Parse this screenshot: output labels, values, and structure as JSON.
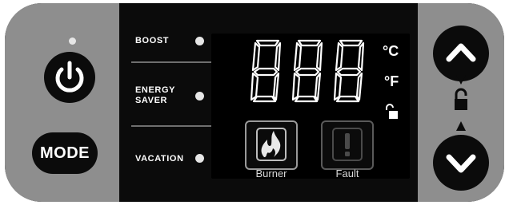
{
  "controls": {
    "mode_label": "MODE"
  },
  "modes": {
    "boost": "BOOST",
    "energy_saver": [
      "ENERGY",
      "SAVER"
    ],
    "vacation": "VACATION"
  },
  "display": {
    "digits": "888",
    "unit_c": "°C",
    "unit_f": "°F",
    "burner_label": "Burner",
    "fault_label": "Fault"
  },
  "colors": {
    "panel": "#0b0b0b",
    "side_zone": "#8e8e8e",
    "led": "#e6e6e6",
    "segment": "#ffffff"
  },
  "icons": {
    "power": "power-icon",
    "flame": "flame-icon",
    "exclamation": "exclamation-icon",
    "unlock": "unlock-icon",
    "lock": "lock-icon",
    "up": "chevron-up-icon",
    "down": "chevron-down-icon"
  }
}
